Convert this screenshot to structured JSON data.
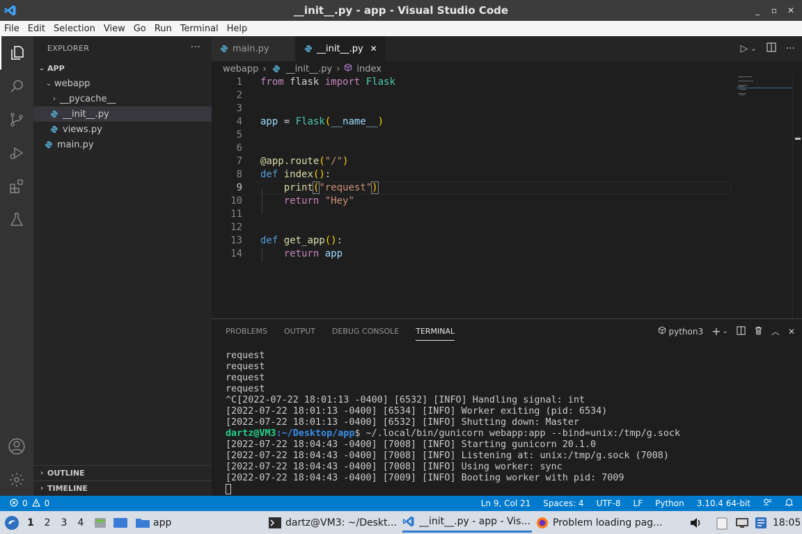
{
  "window": {
    "title": "__init__.py - app - Visual Studio Code",
    "controls": [
      "_",
      "▫",
      "✕"
    ]
  },
  "menu": [
    "File",
    "Edit",
    "Selection",
    "View",
    "Go",
    "Run",
    "Terminal",
    "Help"
  ],
  "sidebar": {
    "header": "EXPLORER",
    "more": "···",
    "root": "APP",
    "items": [
      {
        "label": "webapp"
      },
      {
        "label": "__pycache__"
      },
      {
        "label": "__init__.py"
      },
      {
        "label": "views.py"
      },
      {
        "label": "main.py"
      }
    ],
    "outline": "OUTLINE",
    "timeline": "TIMELINE"
  },
  "tabs": [
    {
      "label": "main.py"
    },
    {
      "label": "__init__.py",
      "close": "✕"
    }
  ],
  "breadcrumb": {
    "folder": "webapp",
    "sep": "›",
    "file": "__init__.py",
    "symbol": "index"
  },
  "editor": {
    "line_numbers": [
      "1",
      "2",
      "3",
      "4",
      "5",
      "6",
      "7",
      "8",
      "9",
      "10",
      "11",
      "12",
      "13",
      "14"
    ],
    "current_line": 9,
    "tokens": {
      "from": "from",
      "flask": "flask",
      "import": "import",
      "Flask": "Flask",
      "app": "app",
      "assign": " = ",
      "name": "__name__",
      "decor": "@app.route",
      "route_arg": "\"/\"",
      "def": "def",
      "index": "index",
      "print": "print",
      "request_str": "\"request\"",
      "return": "return",
      "hey": "\"Hey\"",
      "get_app": "get_app"
    }
  },
  "panel": {
    "tabs": [
      "PROBLEMS",
      "OUTPUT",
      "DEBUG CONSOLE",
      "TERMINAL"
    ],
    "active_tab": "TERMINAL",
    "shell": "python3",
    "terminal_lines": [
      "request",
      "request",
      "request",
      "request",
      "^C[2022-07-22 18:01:13 -0400] [6532] [INFO] Handling signal: int",
      "[2022-07-22 18:01:13 -0400] [6534] [INFO] Worker exiting (pid: 6534)",
      "[2022-07-22 18:01:13 -0400] [6532] [INFO] Shutting down: Master"
    ],
    "prompt_user": "dartz@VM3",
    "prompt_path": ":~/Desktop/app",
    "prompt_cmd": "$ ~/.local/bin/gunicorn webapp:app --bind=unix:/tmp/g.sock",
    "terminal_lines_after": [
      "[2022-07-22 18:04:43 -0400] [7008] [INFO] Starting gunicorn 20.1.0",
      "[2022-07-22 18:04:43 -0400] [7008] [INFO] Listening at: unix:/tmp/g.sock (7008)",
      "[2022-07-22 18:04:43 -0400] [7008] [INFO] Using worker: sync",
      "[2022-07-22 18:04:43 -0400] [7009] [INFO] Booting worker with pid: 7009"
    ]
  },
  "statusbar": {
    "errors": "0",
    "warnings": "0",
    "position": "Ln 9, Col 21",
    "spaces": "Spaces: 4",
    "encoding": "UTF-8",
    "eol": "LF",
    "language": "Python",
    "interpreter": "3.10.4 64-bit"
  },
  "taskbar": {
    "workspaces": [
      "1",
      "2",
      "3",
      "4"
    ],
    "folder": "app",
    "tasks": [
      {
        "label": "dartz@VM3: ~/Deskt..."
      },
      {
        "label": "__init__.py - app - Vis..."
      },
      {
        "label": "Problem loading pag..."
      }
    ],
    "clock": "18:05"
  },
  "colors": {
    "accent": "#007acc",
    "activity": "#333333",
    "sidebar": "#252526",
    "editor": "#1e1e1e"
  }
}
